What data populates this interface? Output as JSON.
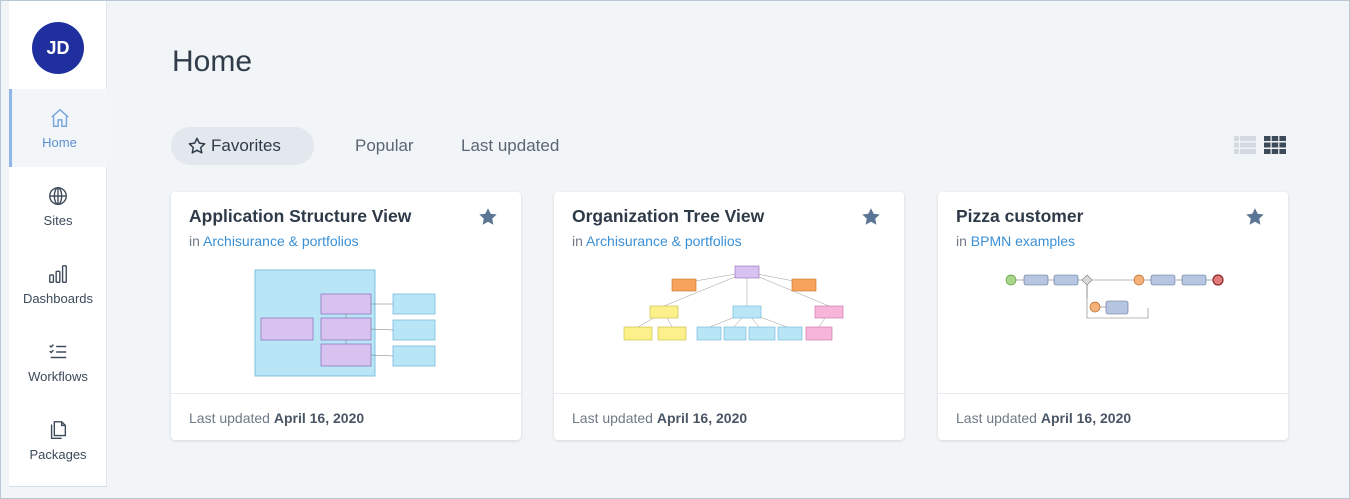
{
  "user": {
    "initials": "JD"
  },
  "sidebar": {
    "items": [
      {
        "label": "Home",
        "icon": "home-icon"
      },
      {
        "label": "Sites",
        "icon": "globe-icon"
      },
      {
        "label": "Dashboards",
        "icon": "bar-chart-icon"
      },
      {
        "label": "Workflows",
        "icon": "checklist-icon"
      },
      {
        "label": "Packages",
        "icon": "document-icon"
      }
    ]
  },
  "page": {
    "title": "Home"
  },
  "tabs": [
    {
      "label": "Favorites",
      "icon": "star-outline-icon"
    },
    {
      "label": "Popular"
    },
    {
      "label": "Last updated"
    }
  ],
  "colors": {
    "accent": "#3a8fd4",
    "avatar": "#1f2f9e",
    "star": "#5c7594"
  },
  "cards": [
    {
      "title": "Application Structure View",
      "in_prefix": "in",
      "location": "Archisurance & portfolios",
      "updated_prefix": "Last updated",
      "updated_date": "April 16, 2020"
    },
    {
      "title": "Organization Tree View",
      "in_prefix": "in",
      "location": "Archisurance & portfolios",
      "updated_prefix": "Last updated",
      "updated_date": "April 16, 2020"
    },
    {
      "title": "Pizza customer",
      "in_prefix": "in",
      "location": "BPMN examples",
      "updated_prefix": "Last updated",
      "updated_date": "April 16, 2020"
    }
  ]
}
